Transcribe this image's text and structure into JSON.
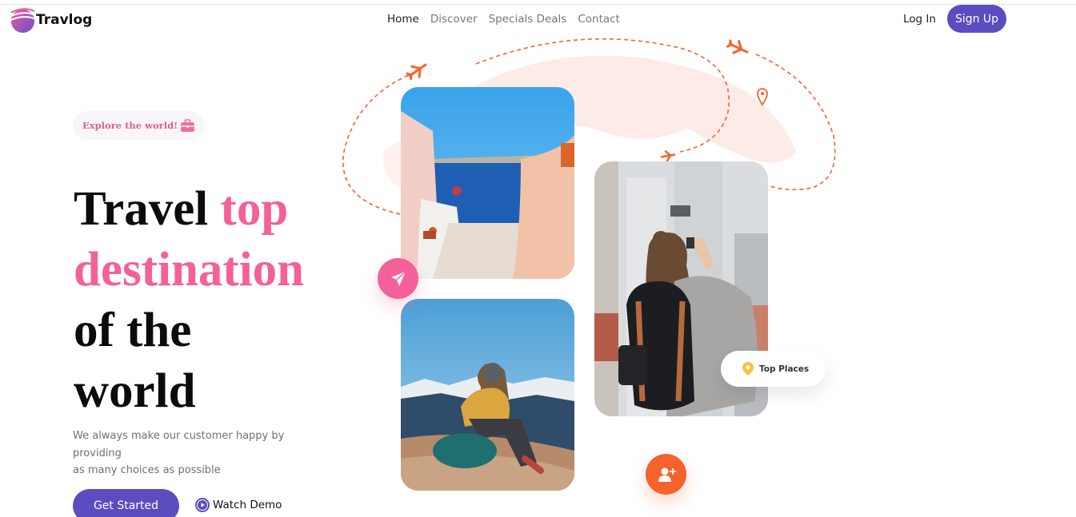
{
  "header": {
    "brand": "Travlog",
    "nav": [
      {
        "label": "Home",
        "active": true
      },
      {
        "label": "Discover",
        "active": false
      },
      {
        "label": "Specials Deals",
        "active": false
      },
      {
        "label": "Contact",
        "active": false
      }
    ],
    "login_label": "Log In",
    "signup_label": "Sign Up"
  },
  "hero": {
    "badge_text": "Explore the world!",
    "headline": {
      "word1": "Travel",
      "word2": "top",
      "line2": "destination",
      "line3": "of the",
      "line4": "world"
    },
    "description_line1": "We always make our customer happy by providing",
    "description_line2": "as many choices as possible",
    "cta_label": "Get Started",
    "watch_label": "Watch Demo"
  },
  "cards": {
    "top_places_label": "Top Places"
  },
  "icons": {
    "brand": "travlog-logo-icon",
    "badge": "briefcase-icon",
    "watch": "play-icon",
    "send": "paper-plane-icon",
    "add_user": "add-user-icon",
    "pin": "location-pin-icon",
    "plane": "airplane-icon"
  },
  "colors": {
    "primary": "#5b4dc0",
    "accent_pink": "#f4609a",
    "accent_orange": "#f5622c",
    "pin_yellow": "#f7c23c"
  }
}
